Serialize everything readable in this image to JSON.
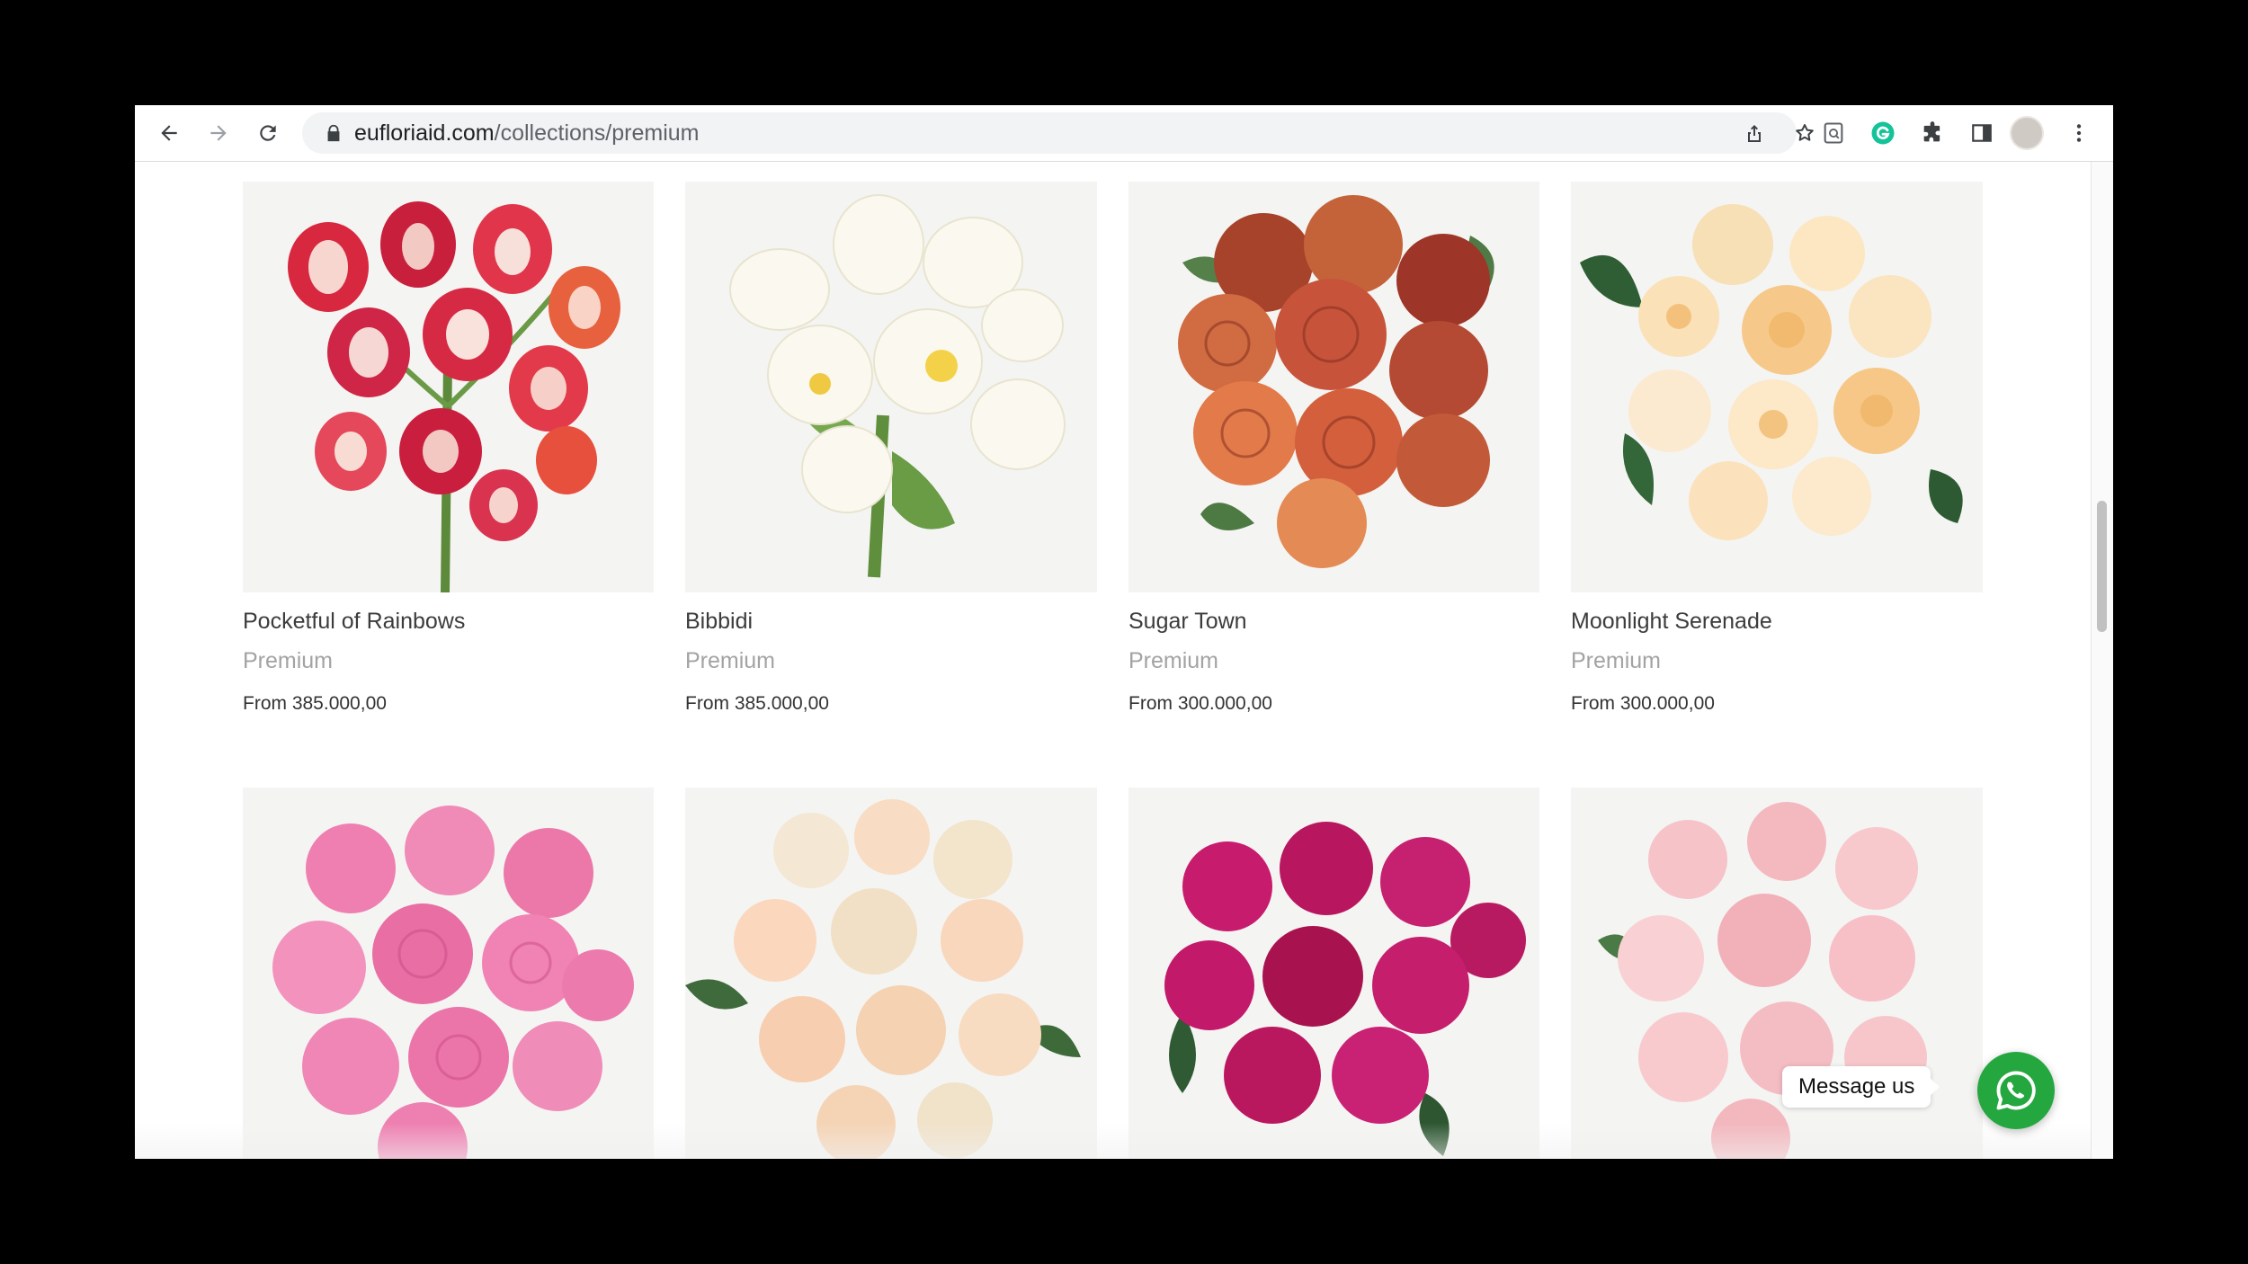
{
  "browser": {
    "url_domain": "eufloriaid.com",
    "url_path": "/collections/premium",
    "icons": [
      "back-arrow-icon",
      "forward-arrow-icon",
      "reload-icon",
      "lock-icon",
      "share-icon",
      "bookmark-star-icon",
      "extension-icon",
      "grammarly-icon",
      "puzzle-extensions-icon",
      "side-panel-icon",
      "profile-avatar",
      "more-vert-icon"
    ]
  },
  "products": [
    {
      "title": "Pocketful of Rainbows",
      "category": "Premium",
      "price": "From 385.000,00",
      "flower": "tulip-red-white"
    },
    {
      "title": "Bibbidi",
      "category": "Premium",
      "price": "From 385.000,00",
      "flower": "tulip-white"
    },
    {
      "title": "Sugar Town",
      "category": "Premium",
      "price": "From 300.000,00",
      "flower": "rose-orange"
    },
    {
      "title": "Moonlight Serenade",
      "category": "Premium",
      "price": "From 300.000,00",
      "flower": "rose-peach"
    },
    {
      "flower": "rose-pink"
    },
    {
      "flower": "rose-cream-peach"
    },
    {
      "flower": "rose-magenta"
    },
    {
      "flower": "rose-light-pink"
    }
  ],
  "chat": {
    "label": "Message us",
    "button_color": "#25a740"
  }
}
